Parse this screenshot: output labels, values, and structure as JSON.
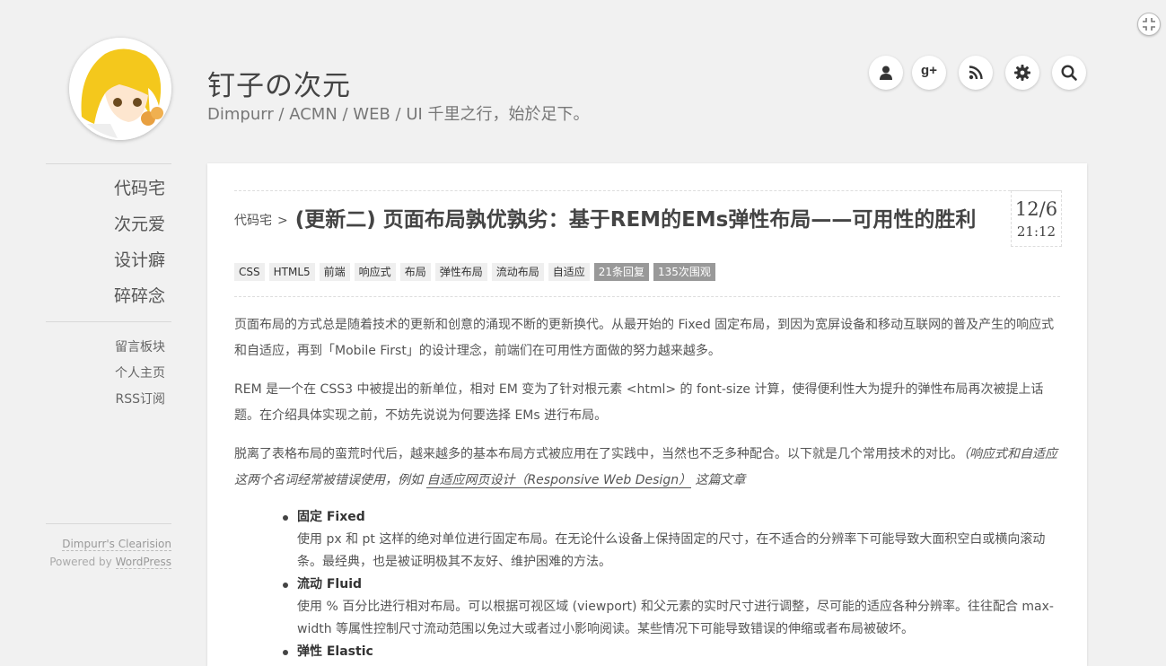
{
  "site": {
    "title": "钉子の次元",
    "subtitle": "Dimpurr / ACMN / WEB / UI 千里之行，始於足下。"
  },
  "header_buttons": [
    {
      "icon": "user-icon"
    },
    {
      "icon": "google-plus-icon",
      "label": "g+"
    },
    {
      "icon": "rss-icon"
    },
    {
      "icon": "gear-icon"
    },
    {
      "icon": "search-icon"
    }
  ],
  "sidebar": {
    "nav": [
      "代码宅",
      "次元爱",
      "设计癖",
      "碎碎念"
    ],
    "links": [
      "留言板块",
      "个人主页",
      "RSS订阅"
    ],
    "footer": {
      "theme_link": "Dimpurr's Clearision",
      "powered_prefix": "Powered by ",
      "powered_link": "WordPress"
    }
  },
  "post": {
    "category": "代码宅",
    "separator": ">",
    "title": "(更新二) 页面布局孰优孰劣：基于REM的EMs弹性布局——可用性的胜利",
    "date_day": "12/6",
    "date_time": "21:12",
    "tags": [
      "CSS",
      "HTML5",
      "前端",
      "响应式",
      "布局",
      "弹性布局",
      "流动布局",
      "自适应"
    ],
    "stats": [
      "21条回复",
      "135次围观"
    ],
    "paragraphs": {
      "p1": "页面布局的方式总是随着技术的更新和创意的涌现不断的更新换代。从最开始的 Fixed 固定布局，到因为宽屏设备和移动互联网的普及产生的响应式和自适应，再到「Mobile First」的设计理念，前端们在可用性方面做的努力越来越多。",
      "p2": "REM 是一个在 CSS3 中被提出的新单位，相对 EM 变为了针对根元素 <html> 的 font-size 计算，使得便利性大为提升的弹性布局再次被提上话题。在介绍具体实现之前，不妨先说说为何要选择 EMs 进行布局。",
      "p3_text": "脱离了表格布局的蛮荒时代后，越来越多的基本布局方式被应用在了实践中，当然也不乏多种配合。以下就是几个常用技术的对比。",
      "p3_em_pre": "（响应式和自适应这两个名词经常被错误使用，例如 ",
      "p3_em_link": "自适应网页设计（Responsive Web Design）",
      "p3_em_post": " 这篇文章"
    },
    "features": [
      {
        "title": "固定 Fixed",
        "desc": "使用 px 和 pt 这样的绝对单位进行固定布局。在无论什么设备上保持固定的尺寸，在不适合的分辨率下可能导致大面积空白或横向滚动条。最经典，也是被证明极其不友好、维护困难的方法。"
      },
      {
        "title": "流动 Fluid",
        "desc": "使用 % 百分比进行相对布局。可以根据可视区域 (viewport) 和父元素的实时尺寸进行调整，尽可能的适应各种分辨率。往往配合 max-width 等属性控制尺寸流动范围以免过大或者过小影响阅读。某些情况下可能导致错误的伸缩或者布局被破坏。"
      },
      {
        "title": "弹性 Elastic",
        "desc": ""
      }
    ]
  }
}
